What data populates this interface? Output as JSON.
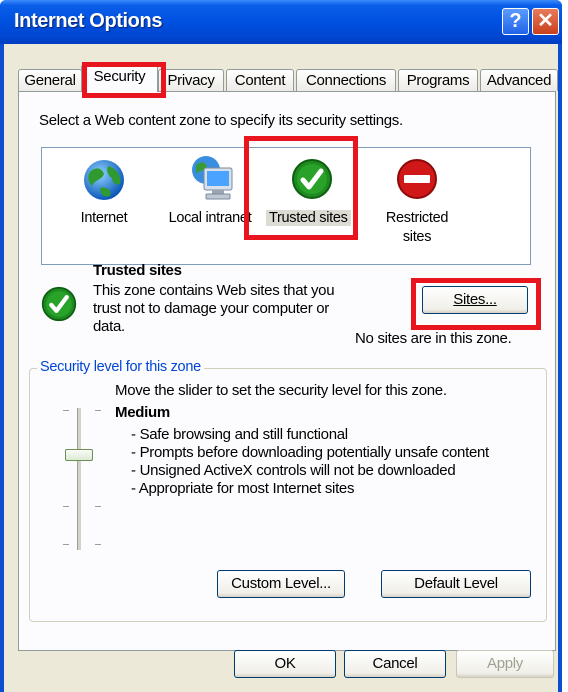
{
  "window": {
    "title": "Internet Options"
  },
  "titlebar_buttons": {
    "help": "?",
    "close": "✕"
  },
  "tabs": [
    "General",
    "Security",
    "Privacy",
    "Content",
    "Connections",
    "Programs",
    "Advanced"
  ],
  "active_tab": "Security",
  "security": {
    "instruction": "Select a Web content zone to specify its security settings.",
    "zones": [
      {
        "label": "Internet",
        "icon": "globe-icon"
      },
      {
        "label": "Local intranet",
        "icon": "intranet-computer-icon"
      },
      {
        "label": "Trusted sites",
        "icon": "trusted-check-icon"
      },
      {
        "label_line1": "Restricted",
        "label_line2": "sites",
        "icon": "restricted-no-entry-icon"
      }
    ],
    "selected_zone": {
      "title": "Trusted sites",
      "desc_line1": "This zone contains Web sites that you",
      "desc_line2": "trust not to damage your computer or",
      "desc_line3": "data.",
      "sites_button": "Sites...",
      "sites_status": "No sites are in this zone."
    },
    "level_group": {
      "title": "Security level for this zone",
      "hint": "Move the slider to set the security level for this zone.",
      "level_name": "Medium",
      "bullets": [
        "- Safe browsing and still functional",
        "- Prompts before downloading potentially unsafe content",
        "- Unsigned ActiveX controls will not be downloaded",
        "- Appropriate for most Internet sites"
      ],
      "custom_button": "Custom Level...",
      "default_button": "Default Level"
    }
  },
  "footer": {
    "ok": "OK",
    "cancel": "Cancel",
    "apply": "Apply"
  },
  "colors": {
    "titlebar": "#0050e0",
    "dialog_bg": "#ece9d8",
    "highlight": "#e8141e",
    "group_title": "#0046d5",
    "trusted_green": "#1f8a20"
  }
}
